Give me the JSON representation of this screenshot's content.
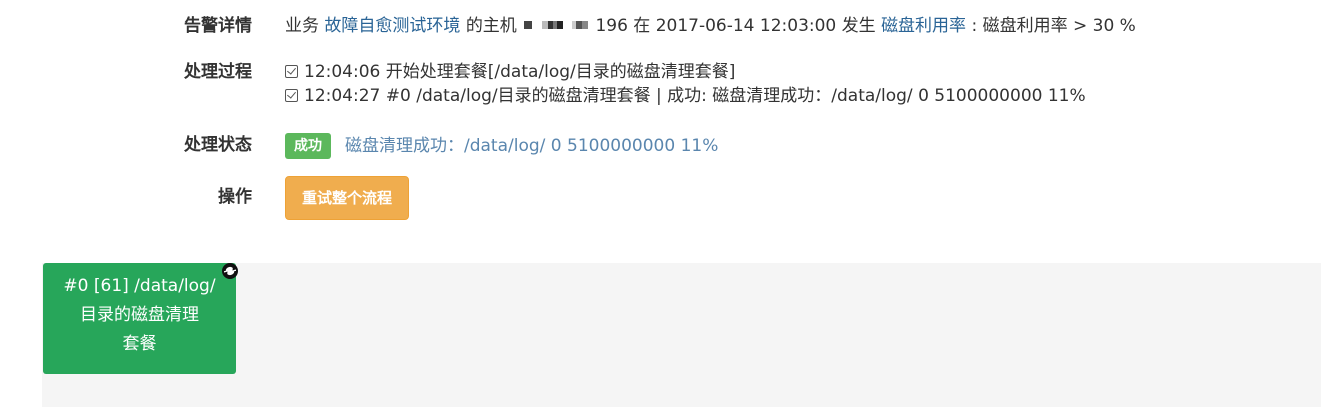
{
  "detail": {
    "label": "告警详情",
    "prefix": "业务",
    "business_link": "故障自愈测试环境",
    "host_text": "的主机",
    "host_suffix": "196 在 2017-06-14 12:03:00 发生",
    "metric_link": "磁盘利用率",
    "condition": ": 磁盘利用率 > 30 %"
  },
  "process": {
    "label": "处理过程",
    "lines": [
      "12:04:06 开始处理套餐[/data/log/目录的磁盘清理套餐]",
      "12:04:27 #0 /data/log/目录的磁盘清理套餐 | 成功: 磁盘清理成功：/data/log/ 0 5100000000 11%"
    ]
  },
  "status": {
    "label": "处理状态",
    "badge": "成功",
    "message": "磁盘清理成功：/data/log/ 0 5100000000 11%"
  },
  "action": {
    "label": "操作",
    "retry_button": "重试整个流程"
  },
  "flow": {
    "node_line1": "#0 [61] /data/log/",
    "node_line2": "目录的磁盘清理",
    "node_line3": "套餐",
    "node_color": "#27a65a"
  },
  "colors": {
    "link": "#2a6496",
    "success": "#5cb85c",
    "warning": "#f0ad4e",
    "status_text": "#5a86ae"
  }
}
